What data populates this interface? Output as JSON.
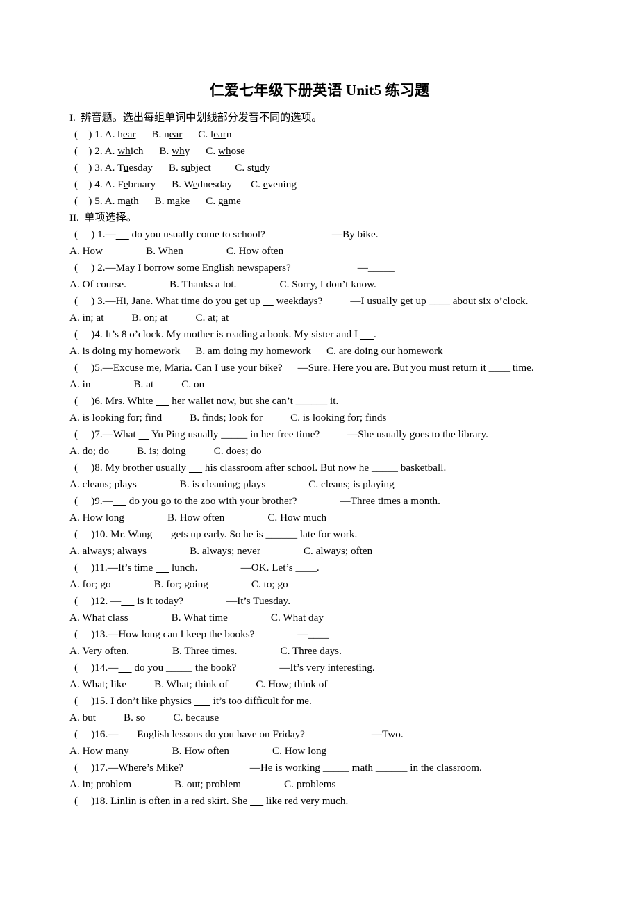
{
  "document": {
    "title": "仁爱七年级下册英语 Unit5 练习题",
    "sections": [
      {
        "heading": "I.  辨音题。选出每组单词中划线部分发音不同的选项。",
        "items": [
          {
            "marker": "(    ) 1. A. h",
            "u1": "ear",
            "t1": "      B. n",
            "u2": "ear",
            "t2": "      C. l",
            "u3": "ear",
            "t3": "n"
          },
          {
            "marker": "(    ) 2. A. ",
            "u1": "wh",
            "t1": "ich      B. ",
            "u2": "wh",
            "t2": "y      C. ",
            "u3": "wh",
            "t3": "ose"
          },
          {
            "marker": "(    ) 3. A. T",
            "u1": "u",
            "t1": "esday      B. s",
            "u2": "u",
            "t2": "bject         C. st",
            "u3": "u",
            "t3": "dy"
          },
          {
            "marker": "(    ) 4. A. F",
            "u1": "e",
            "t1": "bruary      B. W",
            "u2": "e",
            "t2": "dnesday       C. ",
            "u3": "e",
            "t3": "vening"
          },
          {
            "marker": "(    ) 5. A. m",
            "u1": "a",
            "t1": "th      B. m",
            "u2": "a",
            "t2": "ke      C. g",
            "u3": "a",
            "t3": "me"
          }
        ]
      }
    ],
    "section2": {
      "heading": "II.  单项选择。",
      "questions": [
        {
          "stem_a": "(     ) 1.—",
          "blank1": "_____",
          "stem_b": " do you usually come to school?",
          "gap": "xl",
          "reply": "—By bike.",
          "options": [
            "A. How",
            "B. When",
            "C. How often"
          ],
          "opt_gaps": [
            "l",
            "l"
          ]
        },
        {
          "stem_a": "(     ) 2.—May I borrow some English newspapers?",
          "blank1": "",
          "stem_b": "",
          "gap": "xl",
          "reply": "—_____",
          "options": [
            "A. Of course.",
            "B. Thanks a lot.",
            "C. Sorry, I don’t know."
          ],
          "opt_gaps": [
            "l",
            "l"
          ]
        },
        {
          "stem_a": "(     ) 3.—Hi, Jane. What time do you get up ",
          "blank1": "____",
          "stem_b": " weekdays?",
          "gap": "m",
          "reply": "—I usually get up ____ about six o’clock.",
          "options": [
            "A. in; at",
            "B. on; at",
            "C. at; at"
          ],
          "opt_gaps": [
            "m",
            "m"
          ]
        },
        {
          "stem_a": "(     )4. It’s 8 o’clock. My mother is reading a book. My sister and I ",
          "blank1": "_____",
          "stem_b": ".",
          "gap": "",
          "reply": "",
          "options": [
            "A. is doing my homework",
            "B. am doing my homework",
            "C. are doing our homework"
          ],
          "opt_gaps": [
            "s",
            "s"
          ]
        },
        {
          "stem_a": "(     )5.—Excuse me, Maria. Can I use your bike?",
          "blank1": "",
          "stem_b": "",
          "gap": "s",
          "reply": "—Sure. Here you are. But you must return it ____ time.",
          "options": [
            "A. in",
            "B. at",
            "C. on"
          ],
          "opt_gaps": [
            "l",
            "m"
          ]
        },
        {
          "stem_a": "(     )6. Mrs. White ",
          "blank1": "_____",
          "stem_b": " her wallet now, but she can’t ______ it.",
          "gap": "",
          "reply": "",
          "options": [
            "A. is looking for; find",
            "B. finds; look for",
            "C. is looking for; finds"
          ],
          "opt_gaps": [
            "m",
            "m"
          ]
        },
        {
          "stem_a": "(     )7.—What ",
          "blank1": "____",
          "stem_b": " Yu Ping usually _____ in her free time?",
          "gap": "m",
          "reply": "—She usually goes to the library.",
          "options": [
            "A. do; do",
            "B. is; doing",
            "C. does; do"
          ],
          "opt_gaps": [
            "m",
            "m"
          ]
        },
        {
          "stem_a": "(     )8. My brother usually ",
          "blank1": "_____",
          "stem_b": " his classroom after school. But now he _____ basketball.",
          "gap": "",
          "reply": "",
          "options": [
            "A. cleans; plays",
            "B. is cleaning; plays",
            "C. cleans; is playing"
          ],
          "opt_gaps": [
            "l",
            "l"
          ]
        },
        {
          "stem_a": "(     )9.—",
          "blank1": "_____",
          "stem_b": " do you go to the zoo with your brother?",
          "gap": "l",
          "reply": "—Three times a month.",
          "options": [
            "A. How long",
            "B. How often",
            "C. How much"
          ],
          "opt_gaps": [
            "l",
            "l"
          ]
        },
        {
          "stem_a": "(     )10. Mr. Wang ",
          "blank1": "_____",
          "stem_b": " gets up early. So he is ______ late for work.",
          "gap": "",
          "reply": "",
          "options": [
            "A. always; always",
            "B. always; never",
            "C. always; often"
          ],
          "opt_gaps": [
            "l",
            "l"
          ]
        },
        {
          "stem_a": "(     )11.—It’s time ",
          "blank1": "_____",
          "stem_b": " lunch.",
          "gap": "l",
          "reply": "—OK. Let’s ____.",
          "options": [
            "A. for; go",
            "B. for; going",
            "C. to; go"
          ],
          "opt_gaps": [
            "l",
            "l"
          ]
        },
        {
          "stem_a": "(     )12. —",
          "blank1": "_____",
          "stem_b": " is it today?",
          "gap": "l",
          "reply": "—It’s Tuesday.",
          "options": [
            "A. What class",
            "B. What time",
            "C. What day"
          ],
          "opt_gaps": [
            "l",
            "l"
          ]
        },
        {
          "stem_a": "(     )13.—How long can I keep the books?",
          "blank1": "",
          "stem_b": "",
          "gap": "l",
          "reply": "—____",
          "options": [
            "A. Very often.",
            "B. Three times.",
            "C. Three days."
          ],
          "opt_gaps": [
            "l",
            "l"
          ]
        },
        {
          "stem_a": "(     )14.—",
          "blank1": "_____",
          "stem_b": " do you _____ the book?",
          "gap": "l",
          "reply": "—It’s very interesting.",
          "options": [
            "A. What; like",
            "B. What; think of",
            "C. How; think of"
          ],
          "opt_gaps": [
            "m",
            "m"
          ]
        },
        {
          "stem_a": "(     )15. I don’t like physics ",
          "blank1": "______",
          "stem_b": " it’s too difficult for me.",
          "gap": "",
          "reply": "",
          "options": [
            "A. but",
            "B. so",
            "C. because"
          ],
          "opt_gaps": [
            "m",
            "m"
          ]
        },
        {
          "stem_a": "(     )16.—",
          "blank1": "______",
          "stem_b": " English lessons do you have on Friday?",
          "gap": "xl",
          "reply": "—Two.",
          "options": [
            "A. How many",
            "B. How often",
            "C. How long"
          ],
          "opt_gaps": [
            "l",
            "l"
          ]
        },
        {
          "stem_a": "(     )17.—Where’s Mike?",
          "blank1": "",
          "stem_b": "",
          "gap": "xl",
          "reply": "—He is working _____ math ______ in the classroom.",
          "options": [
            "A. in; problem",
            "B. out; problem",
            "C. problems"
          ],
          "opt_gaps": [
            "l",
            "l"
          ]
        },
        {
          "stem_a": "(     )18. Linlin is often in a red skirt. She ",
          "blank1": "_____",
          "stem_b": " like red very much.",
          "gap": "",
          "reply": "",
          "options": [],
          "opt_gaps": []
        }
      ]
    }
  }
}
